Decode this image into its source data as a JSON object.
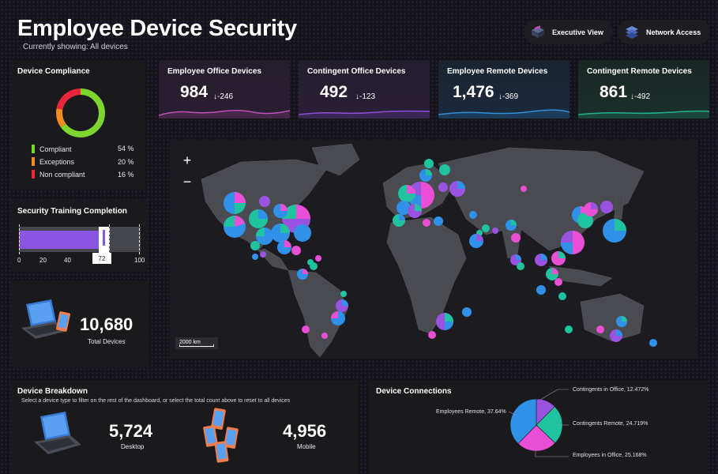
{
  "header": {
    "title": "Employee Device Security",
    "subtitle": "Currently showing: All devices",
    "executive_view_label": "Executive View",
    "network_access_label": "Network Access"
  },
  "kpis": [
    {
      "label": "Employee Office Devices",
      "value": "984",
      "delta": "↓-246",
      "color": "#c14fb4"
    },
    {
      "label": "Contingent Office Devices",
      "value": "492",
      "delta": "↓-123",
      "color": "#8b4fd6"
    },
    {
      "label": "Employee Remote Devices",
      "value": "1,476",
      "delta": "↓-369",
      "color": "#2f8fd8"
    },
    {
      "label": "Contingent Remote Devices",
      "value": "861",
      "delta": "↓-492",
      "color": "#20b08c"
    }
  ],
  "compliance": {
    "title": "Device Compliance",
    "items": [
      {
        "label": "Compliant",
        "pct": "54 %",
        "color": "#7dd62e"
      },
      {
        "label": "Exceptions",
        "pct": "20 %",
        "color": "#f08c1e"
      },
      {
        "label": "Non compliant",
        "pct": "16 %",
        "color": "#e8263c"
      }
    ]
  },
  "training": {
    "title": "Security Training Completion",
    "value": "72",
    "ticks": [
      "0",
      "20",
      "40",
      "100"
    ]
  },
  "total": {
    "value": "10,680",
    "label": "Total Devices"
  },
  "map": {
    "zoom_in": "+",
    "zoom_out": "−",
    "scale": "2000 km"
  },
  "breakdown": {
    "title": "Device Breakdown",
    "instructions": "Select a device type to filter on the rest of the dashboard, or select the total count above to reset to all devices",
    "desktop_value": "5,724",
    "desktop_label": "Desktop",
    "mobile_value": "4,956",
    "mobile_label": "Mobile"
  },
  "connections": {
    "title": "Device Connections",
    "labels": {
      "contingents_office": "Contingents in Office, 12.472%",
      "employees_remote": "Employees Remote, 37.64%",
      "contingents_remote": "Contingents Remote, 24.719%",
      "employees_office": "Employees in Office, 25.168%"
    }
  },
  "chart_data": {
    "type": "pie",
    "title": "Device Connections",
    "categories": [
      "Contingents in Office",
      "Contingents Remote",
      "Employees in Office",
      "Employees Remote"
    ],
    "values": [
      12.472,
      24.719,
      25.168,
      37.64
    ],
    "colors": [
      "#9a52e0",
      "#1fc3a0",
      "#e84fd4",
      "#2f92e8"
    ]
  }
}
